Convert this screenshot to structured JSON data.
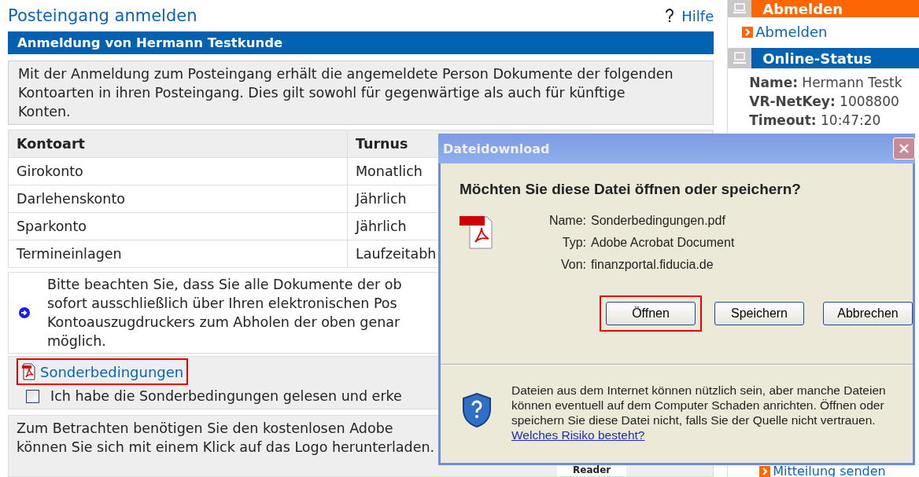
{
  "page_title": "Posteingang anmelden",
  "help_link": "Hilfe",
  "panel_title": "Anmeldung von Hermann Testkunde",
  "intro": "Mit der Anmeldung zum Posteingang erhält die angemeldete Person Dokumente der folgenden Kontoarten in ihren Posteingang. Dies gilt sowohl für gegenwärtige als auch für künftige Konten.",
  "table": {
    "columns": [
      "Kontoart",
      "Turnus"
    ],
    "rows": [
      [
        "Girokonto",
        "Monatlich"
      ],
      [
        "Darlehenskonto",
        "Jährlich"
      ],
      [
        "Sparkonto",
        "Jährlich"
      ],
      [
        "Termineinlagen",
        "Laufzeitabh"
      ]
    ]
  },
  "note_lines": [
    "Bitte beachten Sie, dass Sie alle Dokumente der ob",
    "sofort ausschließlich über Ihren elektronischen Pos",
    "Kontoauszugdruckers zum Abholen der oben genar",
    "möglich."
  ],
  "attachment": {
    "link": "Sonderbedingungen",
    "highlighted": true
  },
  "agreement": {
    "label": "Ich habe die Sonderbedingungen gelesen und erke",
    "checked": false
  },
  "reader_lines": [
    "Zum Betrachten benötigen Sie den kostenlosen Adobe",
    "können Sie sich mit einem Klick auf das Logo herunterladen."
  ],
  "reader_logo": "Reader",
  "sidebar": {
    "logout_title": "Abmelden",
    "logout_link": "Abmelden",
    "status_title": "Online-Status",
    "fields": [
      {
        "label": "Name:",
        "value": "Hermann Testk"
      },
      {
        "label": "VR-NetKey:",
        "value": "1008800"
      },
      {
        "label": "Timeout:",
        "value": "10:47:20"
      }
    ],
    "message_link": "Mitteilung senden"
  },
  "dialog": {
    "title": "Dateidownload",
    "question": "Möchten Sie diese Datei öffnen oder speichern?",
    "details": [
      {
        "label": "Name:",
        "value": "Sonderbedingungen.pdf"
      },
      {
        "label": "Typ:",
        "value": "Adobe Acrobat Document"
      },
      {
        "label": "Von:",
        "value": "finanzportal.fiducia.de"
      }
    ],
    "buttons": [
      {
        "label": "Öffnen",
        "highlighted": true
      },
      {
        "label": "Speichern",
        "highlighted": false
      },
      {
        "label": "Abbrechen",
        "highlighted": false
      }
    ],
    "warning": "Dateien aus dem Internet können nützlich sein, aber manche Dateien können eventuell auf dem Computer Schaden anrichten. Öffnen oder speichern Sie diese Datei nicht, falls Sie der Quelle nicht vertrauen.",
    "risk_link": "Welches Risiko besteht?"
  }
}
